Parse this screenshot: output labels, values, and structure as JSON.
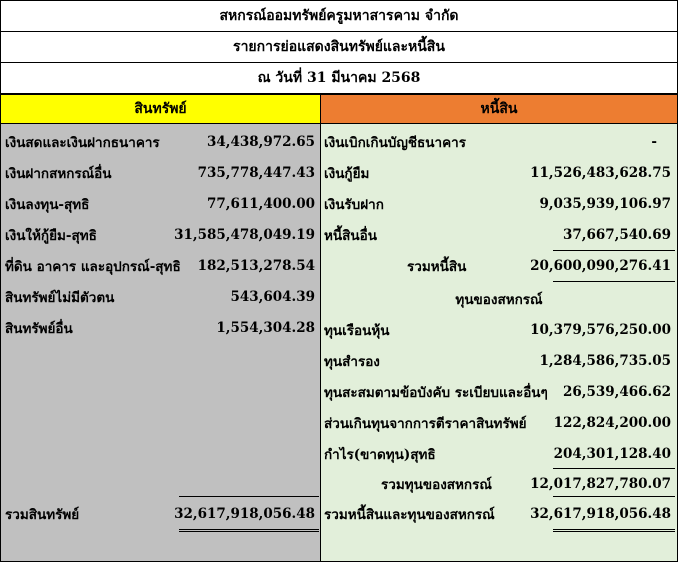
{
  "header": {
    "org_name": "สหกรณ์ออมทรัพย์ครูมหาสารคาม  จำกัด",
    "report_title": "รายการย่อแสดงสินทรัพย์และหนี้สิน",
    "as_of": "ณ  วันที่  31 มีนาคม 2568"
  },
  "assets": {
    "heading": "สินทรัพย์",
    "items": [
      {
        "label": "เงินสดและเงินฝากธนาคาร",
        "value": "34,438,972.65"
      },
      {
        "label": "เงินฝากสหกรณ์อื่น",
        "value": "735,778,447.43"
      },
      {
        "label": "เงินลงทุน-สุทธิ",
        "value": "77,611,400.00"
      },
      {
        "label": "เงินให้กู้ยืม-สุทธิ",
        "value": "31,585,478,049.19"
      },
      {
        "label": "ที่ดิน อาคาร และอุปกรณ์-สุทธิ",
        "value": "182,513,278.54"
      },
      {
        "label": "สินทรัพย์ไม่มีตัวตน",
        "value": "543,604.39"
      },
      {
        "label": "สินทรัพย์อื่น",
        "value": "1,554,304.28"
      }
    ],
    "total_label": "รวมสินทรัพย์",
    "total_value": "32,617,918,056.48"
  },
  "liabilities": {
    "heading": "หนี้สิน",
    "items": [
      {
        "label": "เงินเบิกเกินบัญชีธนาคาร",
        "value": "-"
      },
      {
        "label": "เงินกู้ยืม",
        "value": "11,526,483,628.75"
      },
      {
        "label": "เงินรับฝาก",
        "value": "9,035,939,106.97"
      },
      {
        "label": "หนี้สินอื่น",
        "value": "37,667,540.69"
      }
    ],
    "total_label": "รวมหนี้สิน",
    "total_value": "20,600,090,276.41"
  },
  "equity": {
    "heading": "ทุนของสหกรณ์",
    "items": [
      {
        "label": "ทุนเรือนหุ้น",
        "value": "10,379,576,250.00"
      },
      {
        "label": "ทุนสำรอง",
        "value": "1,284,586,735.05"
      },
      {
        "label": "ทุนสะสมตามข้อบังคับ ระเบียบและอื่นๆ",
        "value": "26,539,466.62"
      },
      {
        "label": "ส่วนเกินทุนจากการตีราคาสินทรัพย์",
        "value": "122,824,200.00"
      },
      {
        "label": "กำไร(ขาดทุน)สุทธิ",
        "value": "204,301,128.40"
      }
    ],
    "total_label": "รวมทุนของสหกรณ์",
    "total_value": "12,017,827,780.07"
  },
  "grand_total": {
    "label": "รวมหนี้สินและทุนของสหกรณ์",
    "value": "32,617,918,056.48"
  }
}
